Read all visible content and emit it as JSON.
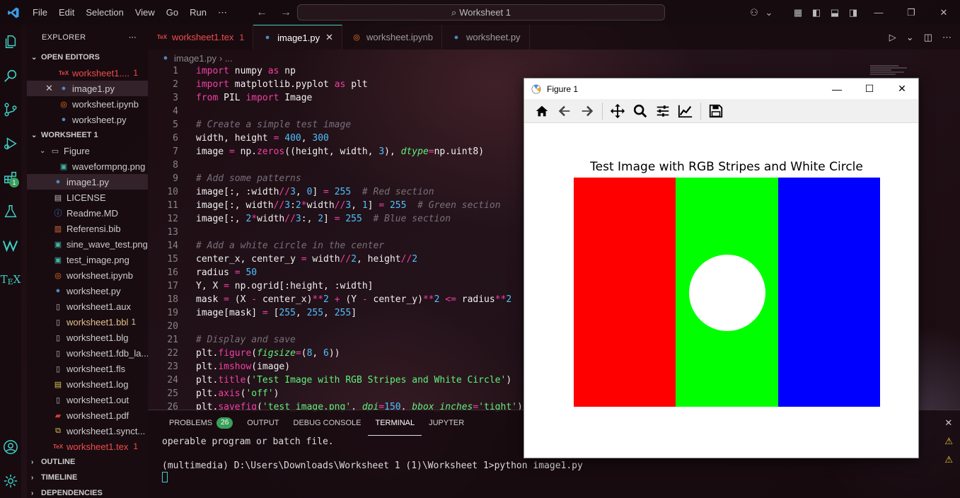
{
  "titlebar": {
    "menu": [
      "File",
      "Edit",
      "Selection",
      "View",
      "Go",
      "Run",
      "⋯"
    ],
    "search": "Worksheet 1"
  },
  "sidebar": {
    "header": "EXPLORER",
    "open_editors_label": "OPEN EDITORS",
    "open_editors": [
      {
        "name": "worksheet1....",
        "badge": "1",
        "icon": "tex"
      },
      {
        "name": "image1.py",
        "badge": "",
        "icon": "py"
      },
      {
        "name": "worksheet.ipynb",
        "badge": "",
        "icon": "nb"
      },
      {
        "name": "worksheet.py",
        "badge": "",
        "icon": "py"
      }
    ],
    "workspace_label": "WORKSHEET 1",
    "folder": "Figure",
    "files": [
      {
        "name": "waveformpng.png",
        "icon": "img",
        "nested": true
      },
      {
        "name": "image1.py",
        "icon": "py"
      },
      {
        "name": "LICENSE",
        "icon": "file"
      },
      {
        "name": "Readme.MD",
        "icon": "info"
      },
      {
        "name": "Referensi.bib",
        "icon": "bib"
      },
      {
        "name": "sine_wave_test.png",
        "icon": "img"
      },
      {
        "name": "test_image.png",
        "icon": "img"
      },
      {
        "name": "worksheet.ipynb",
        "icon": "nb"
      },
      {
        "name": "worksheet.py",
        "icon": "py"
      },
      {
        "name": "worksheet1.aux",
        "icon": "file"
      },
      {
        "name": "worksheet1.bbl",
        "icon": "file",
        "badge": "1"
      },
      {
        "name": "worksheet1.blg",
        "icon": "file"
      },
      {
        "name": "worksheet1.fdb_la...",
        "icon": "file"
      },
      {
        "name": "worksheet1.fls",
        "icon": "file"
      },
      {
        "name": "worksheet1.log",
        "icon": "log"
      },
      {
        "name": "worksheet1.out",
        "icon": "file"
      },
      {
        "name": "worksheet1.pdf",
        "icon": "pdf"
      },
      {
        "name": "worksheet1.synct...",
        "icon": "sync"
      },
      {
        "name": "worksheet1.tex",
        "icon": "tex",
        "badge": "1"
      }
    ],
    "bottom_sections": [
      "OUTLINE",
      "TIMELINE",
      "DEPENDENCIES"
    ],
    "extensions_badge": "1"
  },
  "tabs": [
    {
      "label": "worksheet1.tex",
      "badge": "1",
      "icon": "tex"
    },
    {
      "label": "image1.py",
      "icon": "py",
      "active": true
    },
    {
      "label": "worksheet.ipynb",
      "icon": "nb"
    },
    {
      "label": "worksheet.py",
      "icon": "py"
    }
  ],
  "breadcrumb": {
    "file": "image1.py",
    "rest": "› ..."
  },
  "code_lines": [
    "import numpy as np",
    "import matplotlib.pyplot as plt",
    "from PIL import Image",
    "",
    "# Create a simple test image",
    "width, height = 400, 300",
    "image = np.zeros((height, width, 3), dtype=np.uint8)",
    "",
    "# Add some patterns",
    "image[:, :width//3, 0] = 255  # Red section",
    "image[:, width//3:2*width//3, 1] = 255  # Green section",
    "image[:, 2*width//3:, 2] = 255  # Blue section",
    "",
    "# Add a white circle in the center",
    "center_x, center_y = width//2, height//2",
    "radius = 50",
    "Y, X = np.ogrid[:height, :width]",
    "mask = (X - center_x)**2 + (Y - center_y)**2 <= radius**2",
    "image[mask] = [255, 255, 255]",
    "",
    "# Display and save",
    "plt.figure(figsize=(8, 6))",
    "plt.imshow(image)",
    "plt.title('Test Image with RGB Stripes and White Circle')",
    "plt.axis('off')",
    "plt.savefig('test_image.png', dpi=150, bbox_inches='tight')"
  ],
  "panel": {
    "tabs": [
      {
        "label": "PROBLEMS",
        "badge": "26"
      },
      {
        "label": "OUTPUT"
      },
      {
        "label": "DEBUG CONSOLE"
      },
      {
        "label": "TERMINAL",
        "active": true
      },
      {
        "label": "JUPYTER"
      }
    ],
    "terminal_lines": [
      "operable program or batch file.",
      "",
      "(multimedia) D:\\Users\\Downloads\\Worksheet 1 (1)\\Worksheet 1>python image1.py"
    ]
  },
  "figure": {
    "window_title": "Figure 1",
    "toolbar": [
      "home-icon",
      "back-icon",
      "forward-icon",
      "pan-icon",
      "zoom-icon",
      "configure-subplots-icon",
      "edit-axis-icon",
      "save-icon"
    ],
    "plot_title": "Test Image with RGB Stripes and White Circle",
    "stripes": [
      "#ff0000",
      "#00ff00",
      "#0000ff"
    ],
    "circle_color": "#ffffff"
  },
  "colors": {
    "accent": "#3fd0c4",
    "keyword": "#f33fa5",
    "number": "#4fc1ff",
    "string": "#5ff07b",
    "error": "#f14c4c"
  }
}
